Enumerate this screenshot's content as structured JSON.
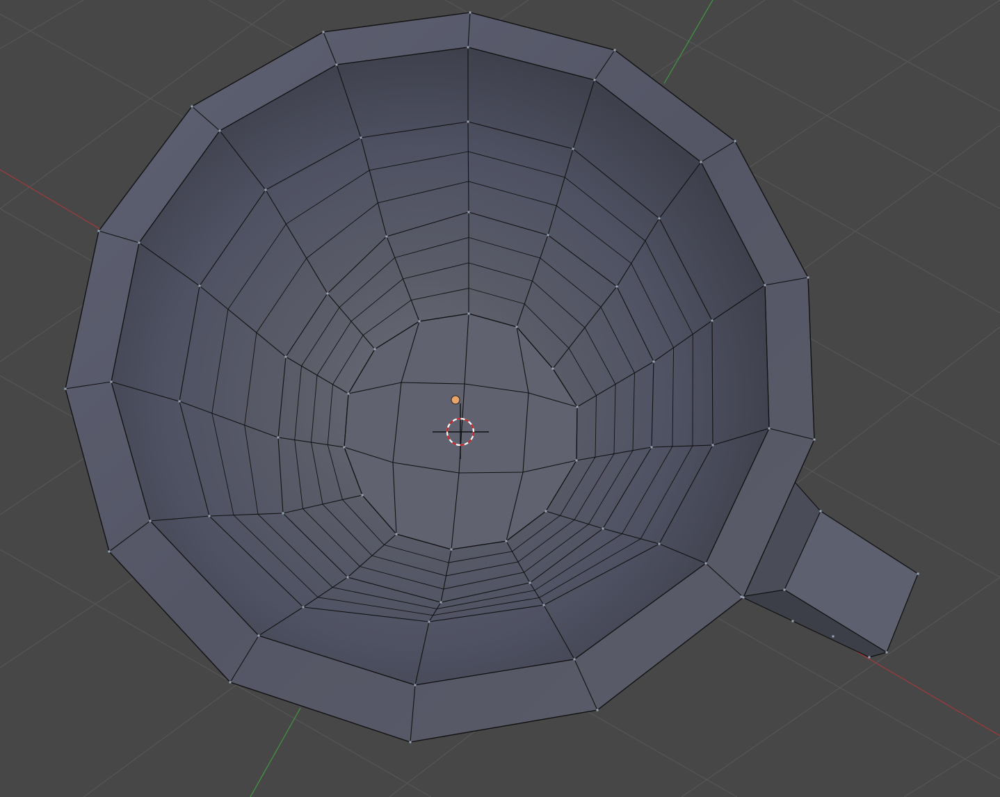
{
  "viewport": {
    "background_color": "#474747",
    "grid_color": "#565656",
    "x_axis_color": "#a33a3a",
    "y_axis_color": "#3f9a3f"
  },
  "mesh": {
    "object": "mug",
    "edit_mode": true,
    "face_color": "#5c5f72",
    "inner_face_color": "#4a4d5c",
    "wire_color": "#111111",
    "vertex_color": "#9aa8b8",
    "origin_color": "#e8a46a",
    "cursor_color": "#cc2222"
  },
  "icons": {
    "origin": "object-origin-icon",
    "cursor": "3d-cursor-icon"
  }
}
